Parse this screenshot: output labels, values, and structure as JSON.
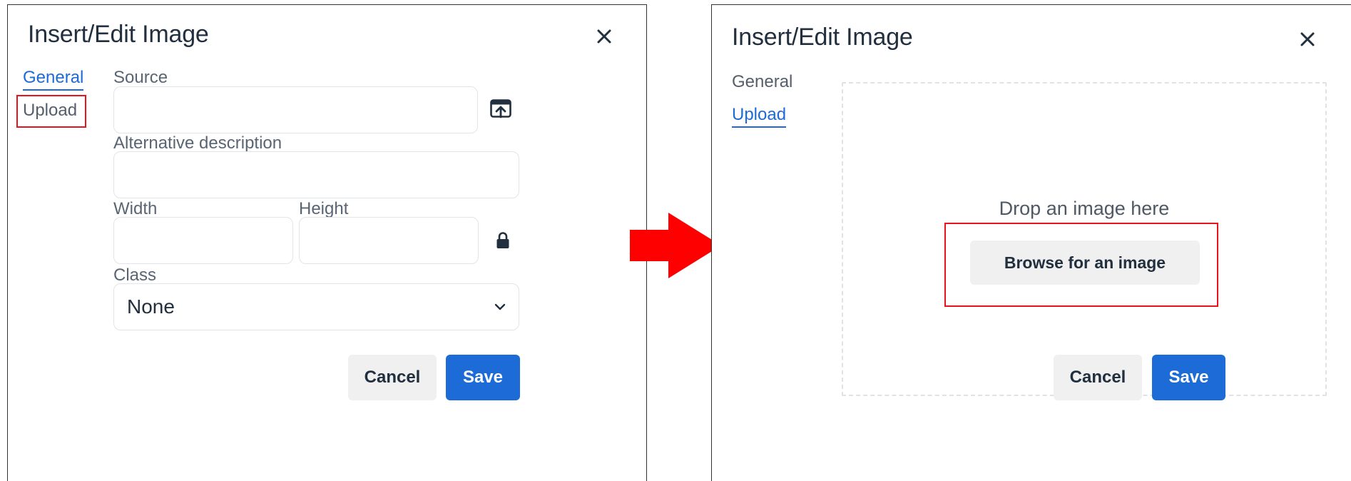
{
  "left_dialog": {
    "title": "Insert/Edit Image",
    "tabs": [
      {
        "label": "General",
        "active": true
      },
      {
        "label": "Upload",
        "active": false
      }
    ],
    "fields": {
      "source": {
        "label": "Source",
        "value": ""
      },
      "alt": {
        "label": "Alternative description",
        "value": ""
      },
      "width": {
        "label": "Width",
        "value": ""
      },
      "height": {
        "label": "Height",
        "value": ""
      },
      "class": {
        "label": "Class",
        "value": "None"
      }
    },
    "buttons": {
      "cancel": "Cancel",
      "save": "Save"
    }
  },
  "right_dialog": {
    "title": "Insert/Edit Image",
    "tabs": [
      {
        "label": "General",
        "active": false
      },
      {
        "label": "Upload",
        "active": true
      }
    ],
    "dropzone_text": "Drop an image here",
    "browse_label": "Browse for an image",
    "buttons": {
      "cancel": "Cancel",
      "save": "Save"
    }
  },
  "icons": {
    "close": "close-icon",
    "upload": "upload-icon",
    "lock": "lock-icon",
    "chevron": "chevron-down-icon",
    "arrow": "right-arrow-icon"
  },
  "colors": {
    "accent": "#1c6bd6",
    "highlight": "#e8141b",
    "arrow": "#ff0000",
    "text": "#222f3e"
  }
}
